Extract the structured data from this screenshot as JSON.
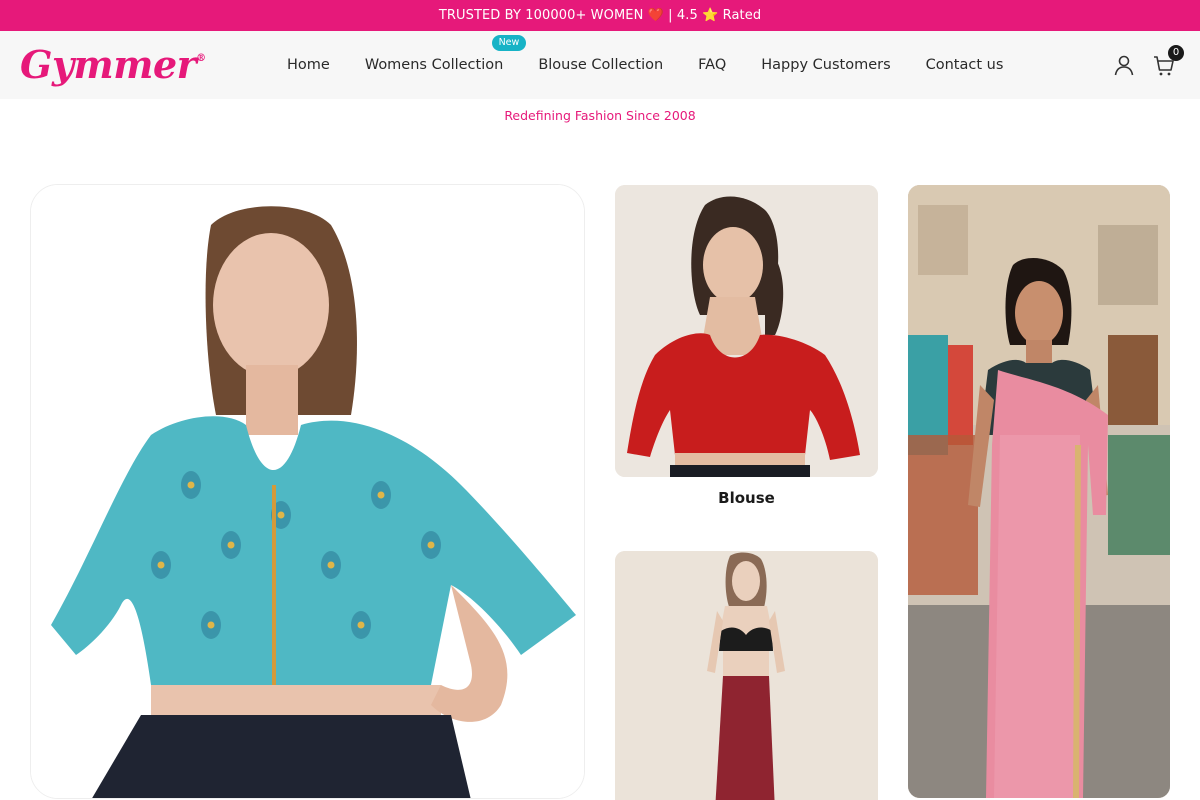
{
  "announcement": "TRUSTED BY 100000+ WOMEN ❤️ | 4.5 ⭐ Rated",
  "brand": {
    "logo_text": "Gymmer",
    "registered_mark": "®",
    "accent": "#e6197a"
  },
  "nav": {
    "items": [
      {
        "label": "Home"
      },
      {
        "label": "Womens Collection",
        "badge": "New"
      },
      {
        "label": "Blouse Collection"
      },
      {
        "label": "FAQ"
      },
      {
        "label": "Happy Customers"
      },
      {
        "label": "Contact us"
      }
    ]
  },
  "header_icons": {
    "account": "user-icon",
    "cart": "shopping-bag-icon",
    "cart_count": "0"
  },
  "tagline": "Redefining Fashion Since 2008",
  "tiles": {
    "large": {
      "image": "model in teal peacock-print zip blouse"
    },
    "blouse": {
      "image": "model in red blouse",
      "caption": "Blouse"
    },
    "shapewear": {
      "image": "model in maroon saree shapewear"
    },
    "saree": {
      "image": "model in pink saree on street"
    }
  }
}
